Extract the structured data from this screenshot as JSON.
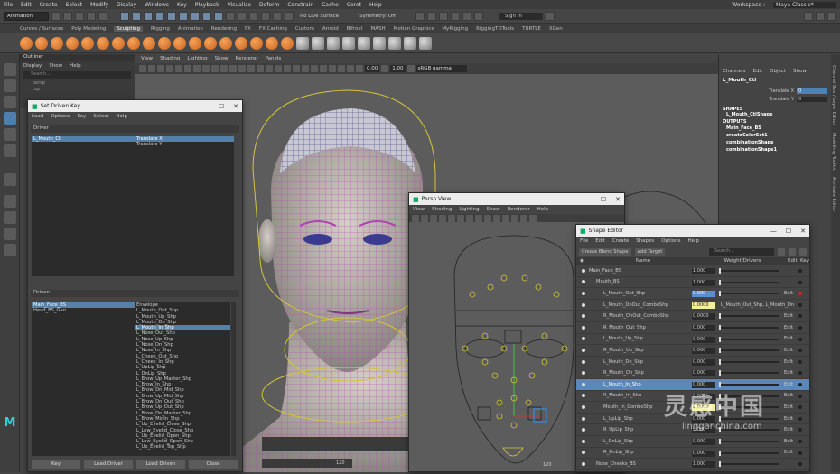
{
  "menubar": {
    "items": [
      "File",
      "Edit",
      "Create",
      "Select",
      "Modify",
      "Display",
      "Windows",
      "Key",
      "Playback",
      "Visualize",
      "Deform",
      "Constrain",
      "Cache",
      "Coret",
      "Help"
    ],
    "workspace_label": "Workspace :",
    "workspace_value": "Maya Classic*"
  },
  "statusline": {
    "mode": "Animation",
    "no_live": "No Live Surface",
    "symmetry": "Symmetry: Off",
    "sign_in": "Sign In"
  },
  "shelf_tabs": [
    "Curves / Surfaces",
    "Poly Modeling",
    "Sculpting",
    "Rigging",
    "Animation",
    "Rendering",
    "FX",
    "FX Caching",
    "Custom",
    "Arnold",
    "Bifrost",
    "MASH",
    "Motion Graphics",
    "MyRigging",
    "RiggingTDTools",
    "TURTLE",
    "XGen"
  ],
  "shelf_active": "Sculpting",
  "outliner": {
    "title": "Outliner",
    "menu": [
      "Display",
      "Show",
      "Help"
    ],
    "search": "Search...",
    "items": [
      "persp",
      "top"
    ]
  },
  "viewport": {
    "menu": [
      "View",
      "Shading",
      "Lighting",
      "Show",
      "Renderer",
      "Panels"
    ],
    "num1": "0.00",
    "num2": "1.00",
    "colorspace": "sRGB gamma"
  },
  "channel_box": {
    "menu_top": [
      "Channels",
      "Edit",
      "Object",
      "Show"
    ],
    "node": "L_Mouth_Ctl",
    "attrs": [
      {
        "name": "Translate X",
        "value": "0"
      },
      {
        "name": "Translate Y",
        "value": "0"
      }
    ],
    "shapes_label": "SHAPES",
    "shape": "L_Mouth_CtlShape",
    "outputs_label": "OUTPUTS",
    "outputs": [
      "Main_Face_BS",
      "createColorSet1",
      "combinationShape",
      "combinationShape1"
    ]
  },
  "right_tabs": [
    "Channel Box / Layer Editor",
    "Modelling Toolkit",
    "Attribute Editor"
  ],
  "sdk": {
    "title": "Set Driven Key",
    "menu": [
      "Load",
      "Options",
      "Key",
      "Select",
      "Help"
    ],
    "driver_label": "Driver",
    "driver_left": [
      "L_Mouth_Ctl"
    ],
    "driver_right": [
      "Translate X",
      "Translate Y"
    ],
    "driven_label": "Driven",
    "driven_left": [
      "Main_Face_BS",
      "Head_BS_Geo"
    ],
    "driven_right": [
      "Envelope",
      "L_Mouth_Out_Shp",
      "L_Mouth_Up_Shp",
      "L_Mouth_Dn_Shp",
      "L_Mouth_In_Shp",
      "L_Nose_Out_Shp",
      "L_Nose_Up_Shp",
      "L_Nose_Dn_Shp",
      "L_Nose_In_Shp",
      "L_Cheek_Out_Shp",
      "L_Cheek_In_Shp",
      "L_UpLip_Shp",
      "L_DnLip_Shp",
      "L_Brow_Up_Master_Shp",
      "L_Brow_In_Shp",
      "L_Brow_Dn_Mid_Shp",
      "L_Brow_Up_Mid_Shp",
      "L_Brow_Dn_Out_Shp",
      "L_Brow_Up_Out_Shp",
      "L_Brow_Dn_Master_Shp",
      "L_Brow_MidIn_Shp",
      "L_Up_Eyelid_Close_Shp",
      "L_Low_Eyelid_Close_Shp",
      "L_Up_Eyelid_Open_Shp",
      "L_Low_Eyelid_Open_Shp",
      "L_Up_Eyelid_Top_Shp"
    ],
    "buttons": [
      "Key",
      "Load Driver",
      "Load Driven",
      "Close"
    ]
  },
  "persp": {
    "title": "Persp View",
    "menu": [
      "View",
      "Shading",
      "Lighting",
      "Show",
      "Renderer",
      "Help"
    ]
  },
  "shape_editor": {
    "title": "Shape Editor",
    "menu": [
      "File",
      "Edit",
      "Create",
      "Shapes",
      "Options",
      "Help"
    ],
    "create_bs": "Create Blend Shape",
    "add_target": "Add Target",
    "search": "Search...",
    "col_name": "Name",
    "col_weight": "Weight/Drivers",
    "col_edit": "Edit",
    "col_key": "Key",
    "rows": [
      {
        "name": "Main_Face_BS",
        "value": "1.000",
        "edit": "",
        "indent": 0,
        "style": "",
        "key": ""
      },
      {
        "name": "Mouth_BS",
        "value": "1.000",
        "edit": "",
        "indent": 1,
        "style": "",
        "key": ""
      },
      {
        "name": "L_Mouth_Out_Shp",
        "value": "0.000",
        "edit": "Edit",
        "indent": 2,
        "style": "blue",
        "key": "red"
      },
      {
        "name": "L_Mouth_DnOut_ComboShp",
        "value": "0.0000",
        "edit": "L_Mouth_Out_Shp, L_Mouth_Dn",
        "indent": 2,
        "style": "yel",
        "key": ""
      },
      {
        "name": "R_Mouth_DnOut_ComboShp",
        "value": "0.0000",
        "edit": "Edit",
        "indent": 2,
        "style": "",
        "key": ""
      },
      {
        "name": "R_Mouth_Out_Shp",
        "value": "0.000",
        "edit": "Edit",
        "indent": 2,
        "style": "",
        "key": ""
      },
      {
        "name": "L_Mouth_Up_Shp",
        "value": "0.000",
        "edit": "Edit",
        "indent": 2,
        "style": "",
        "key": ""
      },
      {
        "name": "R_Mouth_Up_Shp",
        "value": "0.000",
        "edit": "Edit",
        "indent": 2,
        "style": "",
        "key": ""
      },
      {
        "name": "L_Mouth_Dn_Shp",
        "value": "0.000",
        "edit": "Edit",
        "indent": 2,
        "style": "",
        "key": ""
      },
      {
        "name": "R_Mouth_Dn_Shp",
        "value": "0.000",
        "edit": "Edit",
        "indent": 2,
        "style": "",
        "key": ""
      },
      {
        "name": "L_Mouth_In_Shp",
        "value": "0.000",
        "edit": "Edit",
        "indent": 2,
        "style": "sel",
        "key": ""
      },
      {
        "name": "R_Mouth_In_Shp",
        "value": "0.000",
        "edit": "Edit",
        "indent": 2,
        "style": "",
        "key": ""
      },
      {
        "name": "Mouth_In_ComboShp",
        "value": "0.0000",
        "edit": "Edit",
        "indent": 2,
        "style": "yel",
        "key": ""
      },
      {
        "name": "L_UpLip_Shp",
        "value": "0.000",
        "edit": "Edit",
        "indent": 2,
        "style": "",
        "key": ""
      },
      {
        "name": "R_UpLip_Shp",
        "value": "0.000",
        "edit": "Edit",
        "indent": 2,
        "style": "",
        "key": ""
      },
      {
        "name": "L_DnLip_Shp",
        "value": "0.000",
        "edit": "Edit",
        "indent": 2,
        "style": "",
        "key": ""
      },
      {
        "name": "R_DnLip_Shp",
        "value": "0.000",
        "edit": "Edit",
        "indent": 2,
        "style": "",
        "key": ""
      },
      {
        "name": "Nose_Cheeks_BS",
        "value": "1.000",
        "edit": "",
        "indent": 1,
        "style": "",
        "key": ""
      }
    ]
  },
  "timeline": {
    "frame_a": "120",
    "frame_b": "120"
  },
  "watermark": {
    "cn": "灵感中国",
    "url": "lingganchina.com"
  }
}
